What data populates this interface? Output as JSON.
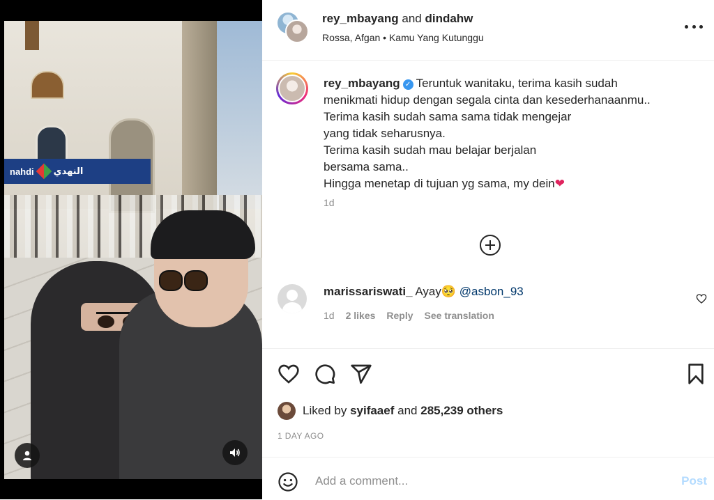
{
  "post": {
    "header": {
      "user1": "rey_mbayang",
      "joiner": "and",
      "user2": "dindahw",
      "artist": "Rossa, Afgan",
      "separator": "•",
      "song": "Kamu Yang Kutunggu"
    },
    "caption": {
      "username": "rey_mbayang",
      "verified_glyph": "✓",
      "lines": [
        "Teruntuk wanitaku, terima kasih sudah",
        "menikmati hidup dengan segala cinta dan kesederhanaanmu..",
        "Terima kasih sudah sama sama tidak mengejar",
        "yang tidak seharusnya.",
        "Terima kasih sudah mau belajar berjalan",
        "bersama sama..",
        "Hingga menetap di tujuan yg sama, my dein"
      ],
      "heart_emoji": "❤",
      "time": "1d"
    },
    "media": {
      "store_sign": "nahdi",
      "store_sign_arabic": "النهدي"
    }
  },
  "comment": {
    "username": "marissariswati_",
    "text": "Ayay",
    "emoji": "🥺",
    "mention": "@asbon_93",
    "time": "1d",
    "likes": "2 likes",
    "reply_label": "Reply",
    "translate_label": "See translation"
  },
  "likes": {
    "prefix": "Liked by",
    "user": "syifaaef",
    "joiner": "and",
    "others": "285,239 others"
  },
  "post_date": "1 DAY AGO",
  "comment_box": {
    "placeholder": "Add a comment...",
    "post_label": "Post"
  },
  "colors": {
    "verified": "#3897f0",
    "post_button_disabled": "#b3dbff",
    "mention": "#00376b"
  },
  "icons": {
    "more": "more-horizontal-icon",
    "load_more": "plus-circle-icon",
    "comment_like": "heart-outline-icon",
    "like": "heart-outline-icon",
    "comment": "chat-bubble-icon",
    "share": "send-paper-plane-icon",
    "save": "bookmark-icon",
    "emoji": "smiley-icon",
    "user_tag": "user-silhouette-icon",
    "audio": "speaker-icon"
  }
}
